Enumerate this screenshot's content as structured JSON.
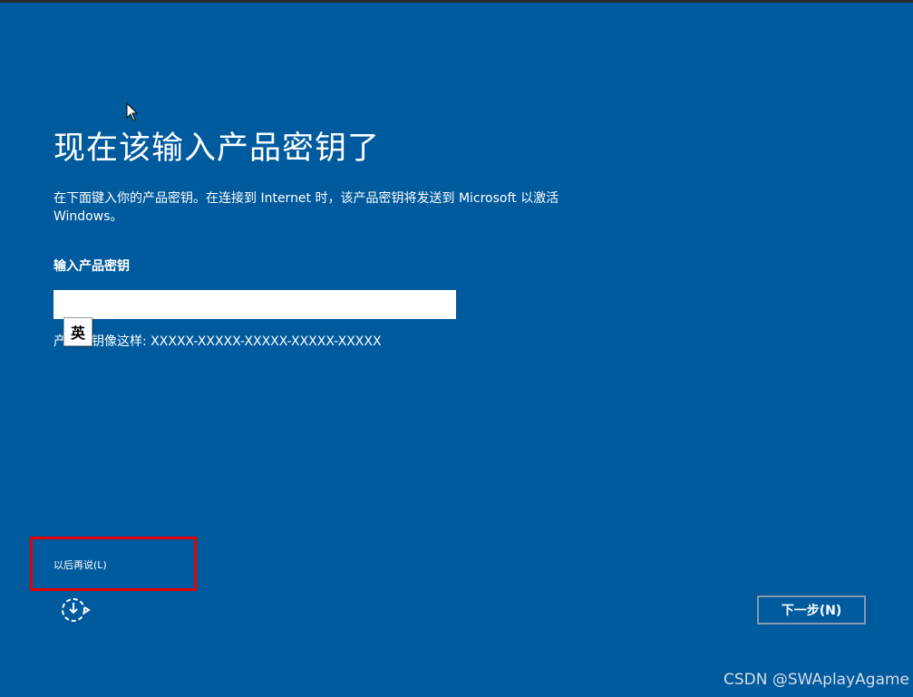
{
  "title": "现在该输入产品密钥了",
  "description": "在下面键入你的产品密钥。在连接到 Internet 时，该产品密钥将发送到 Microsoft 以激活 Windows。",
  "field_label": "输入产品密钥",
  "key_input": {
    "value": "",
    "placeholder": ""
  },
  "hint": "产品密钥像这样: XXXXX-XXXXX-XXXXX-XXXXX-XXXXX",
  "ime_indicator": "英",
  "skip_link": "以后再说(L)",
  "next_button": "下一步(N)",
  "watermark": "CSDN @SWAplayAgame",
  "icons": {
    "cursor": "mouse-pointer-icon",
    "accessibility": "ease-of-access-icon"
  },
  "colors": {
    "background": "#005a9e",
    "text": "#ffffff",
    "highlight": "#e80000",
    "button_border": "#8a9aab"
  }
}
